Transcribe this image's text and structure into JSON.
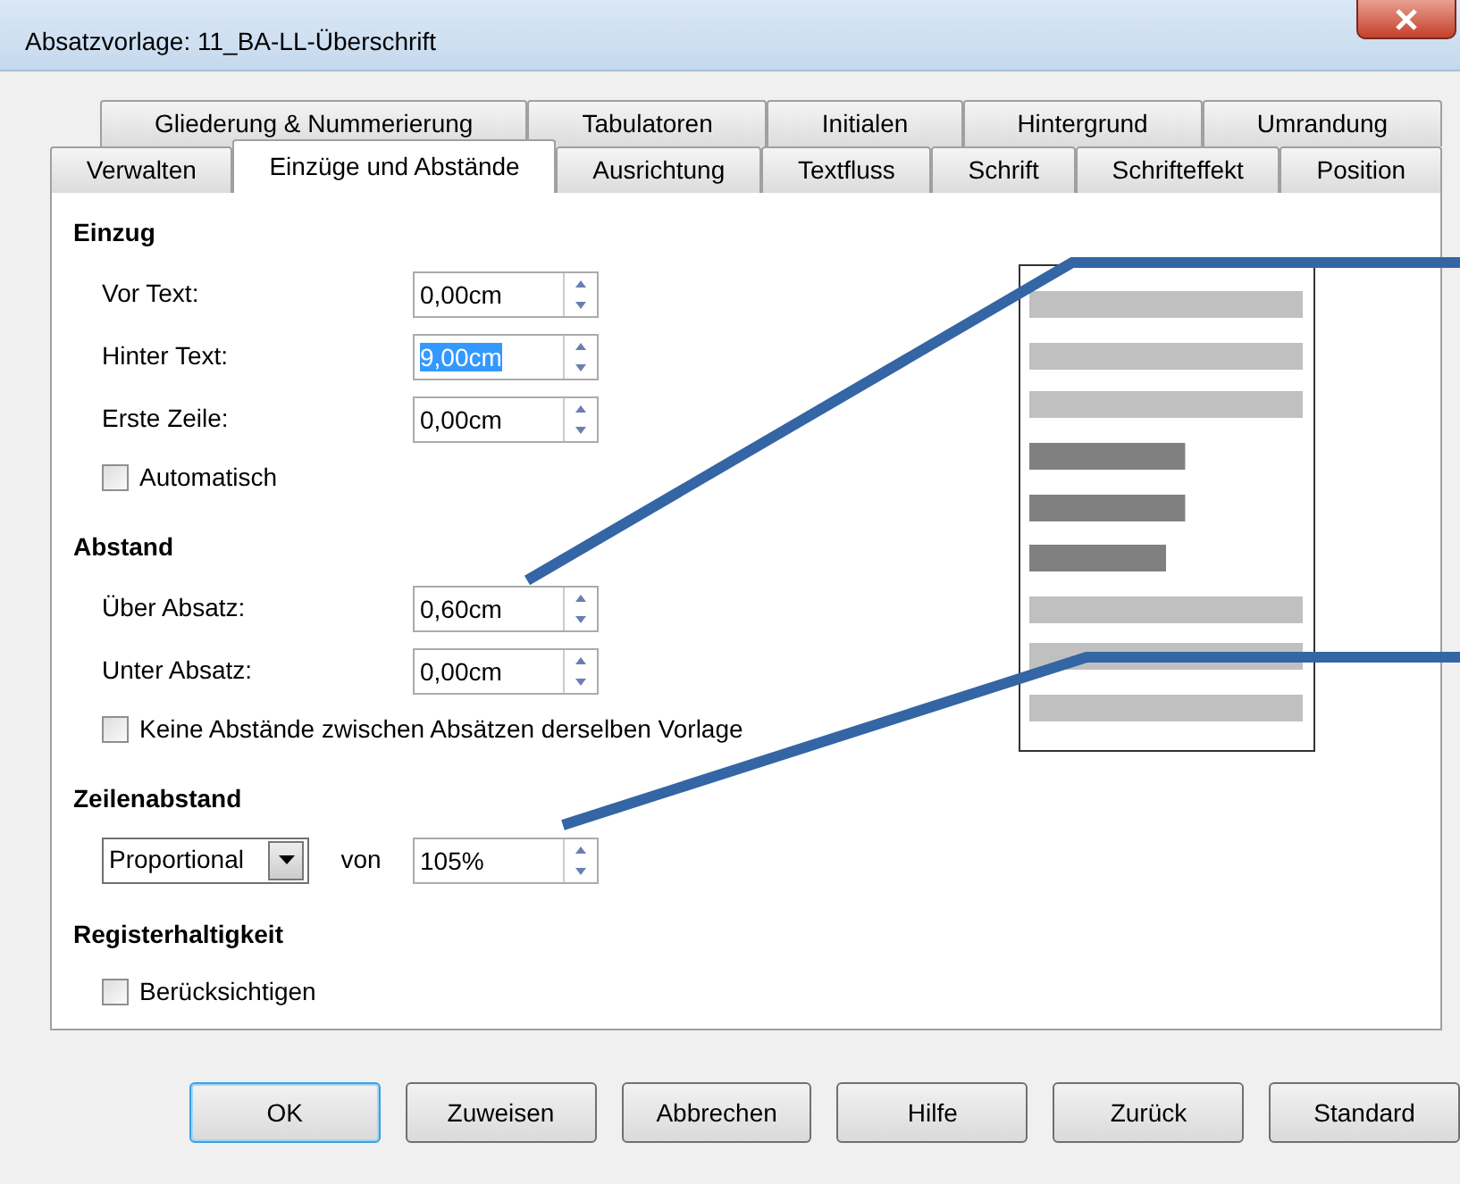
{
  "window": {
    "title": "Absatzvorlage: 11_BA-LL-Überschrift"
  },
  "tab_rows": [
    [
      {
        "label": "Gliederung & Nummerierung",
        "selected": false
      },
      {
        "label": "Tabulatoren",
        "selected": false
      },
      {
        "label": "Initialen",
        "selected": false
      },
      {
        "label": "Hintergrund",
        "selected": false
      },
      {
        "label": "Umrandung",
        "selected": false
      }
    ],
    [
      {
        "label": "Verwalten",
        "selected": false
      },
      {
        "label": "Einzüge und Abstände",
        "selected": true
      },
      {
        "label": "Ausrichtung",
        "selected": false
      },
      {
        "label": "Textfluss",
        "selected": false
      },
      {
        "label": "Schrift",
        "selected": false
      },
      {
        "label": "Schrifteffekt",
        "selected": false
      },
      {
        "label": "Position",
        "selected": false
      }
    ]
  ],
  "sections": [
    {
      "heading": "Einzug",
      "items": [
        {
          "kind": "spin",
          "label": "Vor Text:",
          "value": "0,00cm",
          "text_selected": false
        },
        {
          "kind": "spin",
          "label": "Hinter Text:",
          "value": "9,00cm",
          "text_selected": true
        },
        {
          "kind": "spin",
          "label": "Erste Zeile:",
          "value": "0,00cm",
          "text_selected": false
        },
        {
          "kind": "checkbox",
          "label": "Automatisch",
          "checked": false
        }
      ]
    },
    {
      "heading": "Abstand",
      "items": [
        {
          "kind": "spin",
          "label": "Über Absatz:",
          "value": "0,60cm",
          "text_selected": false
        },
        {
          "kind": "spin",
          "label": "Unter Absatz:",
          "value": "0,00cm",
          "text_selected": false
        },
        {
          "kind": "checkbox",
          "label": "Keine Abstände zwischen Absätzen derselben Vorlage",
          "checked": false
        }
      ]
    },
    {
      "heading": "Zeilenabstand",
      "items": [
        {
          "kind": "combo",
          "value": "Proportional",
          "label": "von",
          "spin_value": "105%"
        }
      ]
    },
    {
      "heading": "Registerhaltigkeit",
      "items": [
        {
          "kind": "checkbox",
          "label": "Berücksichtigen",
          "checked": false
        }
      ]
    }
  ],
  "buttons": [
    {
      "label": "OK",
      "default": true
    },
    {
      "label": "Zuweisen",
      "default": false
    },
    {
      "label": "Abbrechen",
      "default": false
    },
    {
      "label": "Hilfe",
      "default": false
    },
    {
      "label": "Zurück",
      "default": false
    },
    {
      "label": "Standard",
      "default": false
    }
  ]
}
